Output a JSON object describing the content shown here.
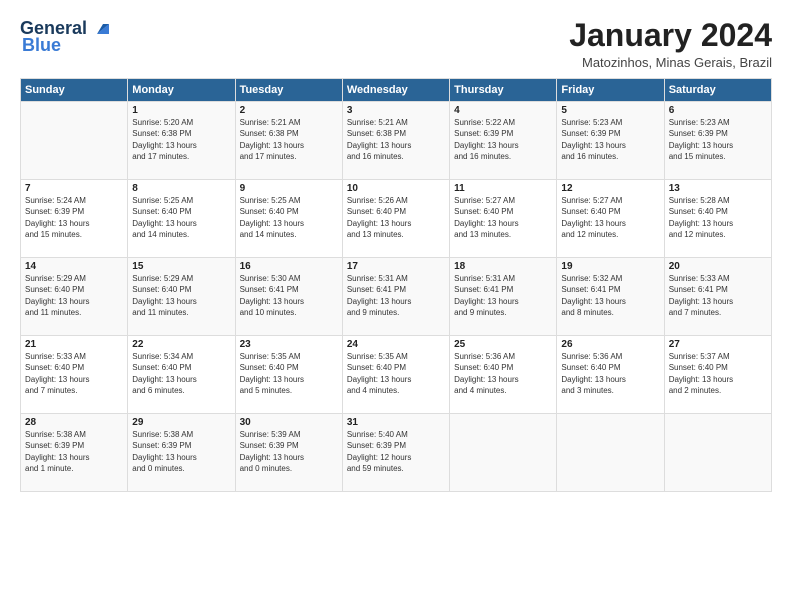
{
  "logo": {
    "line1": "General",
    "line2": "Blue"
  },
  "title": "January 2024",
  "location": "Matozinhos, Minas Gerais, Brazil",
  "days_of_week": [
    "Sunday",
    "Monday",
    "Tuesday",
    "Wednesday",
    "Thursday",
    "Friday",
    "Saturday"
  ],
  "weeks": [
    [
      {
        "day": "",
        "content": ""
      },
      {
        "day": "1",
        "content": "Sunrise: 5:20 AM\nSunset: 6:38 PM\nDaylight: 13 hours\nand 17 minutes."
      },
      {
        "day": "2",
        "content": "Sunrise: 5:21 AM\nSunset: 6:38 PM\nDaylight: 13 hours\nand 17 minutes."
      },
      {
        "day": "3",
        "content": "Sunrise: 5:21 AM\nSunset: 6:38 PM\nDaylight: 13 hours\nand 16 minutes."
      },
      {
        "day": "4",
        "content": "Sunrise: 5:22 AM\nSunset: 6:39 PM\nDaylight: 13 hours\nand 16 minutes."
      },
      {
        "day": "5",
        "content": "Sunrise: 5:23 AM\nSunset: 6:39 PM\nDaylight: 13 hours\nand 16 minutes."
      },
      {
        "day": "6",
        "content": "Sunrise: 5:23 AM\nSunset: 6:39 PM\nDaylight: 13 hours\nand 15 minutes."
      }
    ],
    [
      {
        "day": "7",
        "content": "Sunrise: 5:24 AM\nSunset: 6:39 PM\nDaylight: 13 hours\nand 15 minutes."
      },
      {
        "day": "8",
        "content": "Sunrise: 5:25 AM\nSunset: 6:40 PM\nDaylight: 13 hours\nand 14 minutes."
      },
      {
        "day": "9",
        "content": "Sunrise: 5:25 AM\nSunset: 6:40 PM\nDaylight: 13 hours\nand 14 minutes."
      },
      {
        "day": "10",
        "content": "Sunrise: 5:26 AM\nSunset: 6:40 PM\nDaylight: 13 hours\nand 13 minutes."
      },
      {
        "day": "11",
        "content": "Sunrise: 5:27 AM\nSunset: 6:40 PM\nDaylight: 13 hours\nand 13 minutes."
      },
      {
        "day": "12",
        "content": "Sunrise: 5:27 AM\nSunset: 6:40 PM\nDaylight: 13 hours\nand 12 minutes."
      },
      {
        "day": "13",
        "content": "Sunrise: 5:28 AM\nSunset: 6:40 PM\nDaylight: 13 hours\nand 12 minutes."
      }
    ],
    [
      {
        "day": "14",
        "content": "Sunrise: 5:29 AM\nSunset: 6:40 PM\nDaylight: 13 hours\nand 11 minutes."
      },
      {
        "day": "15",
        "content": "Sunrise: 5:29 AM\nSunset: 6:40 PM\nDaylight: 13 hours\nand 11 minutes."
      },
      {
        "day": "16",
        "content": "Sunrise: 5:30 AM\nSunset: 6:41 PM\nDaylight: 13 hours\nand 10 minutes."
      },
      {
        "day": "17",
        "content": "Sunrise: 5:31 AM\nSunset: 6:41 PM\nDaylight: 13 hours\nand 9 minutes."
      },
      {
        "day": "18",
        "content": "Sunrise: 5:31 AM\nSunset: 6:41 PM\nDaylight: 13 hours\nand 9 minutes."
      },
      {
        "day": "19",
        "content": "Sunrise: 5:32 AM\nSunset: 6:41 PM\nDaylight: 13 hours\nand 8 minutes."
      },
      {
        "day": "20",
        "content": "Sunrise: 5:33 AM\nSunset: 6:41 PM\nDaylight: 13 hours\nand 7 minutes."
      }
    ],
    [
      {
        "day": "21",
        "content": "Sunrise: 5:33 AM\nSunset: 6:40 PM\nDaylight: 13 hours\nand 7 minutes."
      },
      {
        "day": "22",
        "content": "Sunrise: 5:34 AM\nSunset: 6:40 PM\nDaylight: 13 hours\nand 6 minutes."
      },
      {
        "day": "23",
        "content": "Sunrise: 5:35 AM\nSunset: 6:40 PM\nDaylight: 13 hours\nand 5 minutes."
      },
      {
        "day": "24",
        "content": "Sunrise: 5:35 AM\nSunset: 6:40 PM\nDaylight: 13 hours\nand 4 minutes."
      },
      {
        "day": "25",
        "content": "Sunrise: 5:36 AM\nSunset: 6:40 PM\nDaylight: 13 hours\nand 4 minutes."
      },
      {
        "day": "26",
        "content": "Sunrise: 5:36 AM\nSunset: 6:40 PM\nDaylight: 13 hours\nand 3 minutes."
      },
      {
        "day": "27",
        "content": "Sunrise: 5:37 AM\nSunset: 6:40 PM\nDaylight: 13 hours\nand 2 minutes."
      }
    ],
    [
      {
        "day": "28",
        "content": "Sunrise: 5:38 AM\nSunset: 6:39 PM\nDaylight: 13 hours\nand 1 minute."
      },
      {
        "day": "29",
        "content": "Sunrise: 5:38 AM\nSunset: 6:39 PM\nDaylight: 13 hours\nand 0 minutes."
      },
      {
        "day": "30",
        "content": "Sunrise: 5:39 AM\nSunset: 6:39 PM\nDaylight: 13 hours\nand 0 minutes."
      },
      {
        "day": "31",
        "content": "Sunrise: 5:40 AM\nSunset: 6:39 PM\nDaylight: 12 hours\nand 59 minutes."
      },
      {
        "day": "",
        "content": ""
      },
      {
        "day": "",
        "content": ""
      },
      {
        "day": "",
        "content": ""
      }
    ]
  ]
}
